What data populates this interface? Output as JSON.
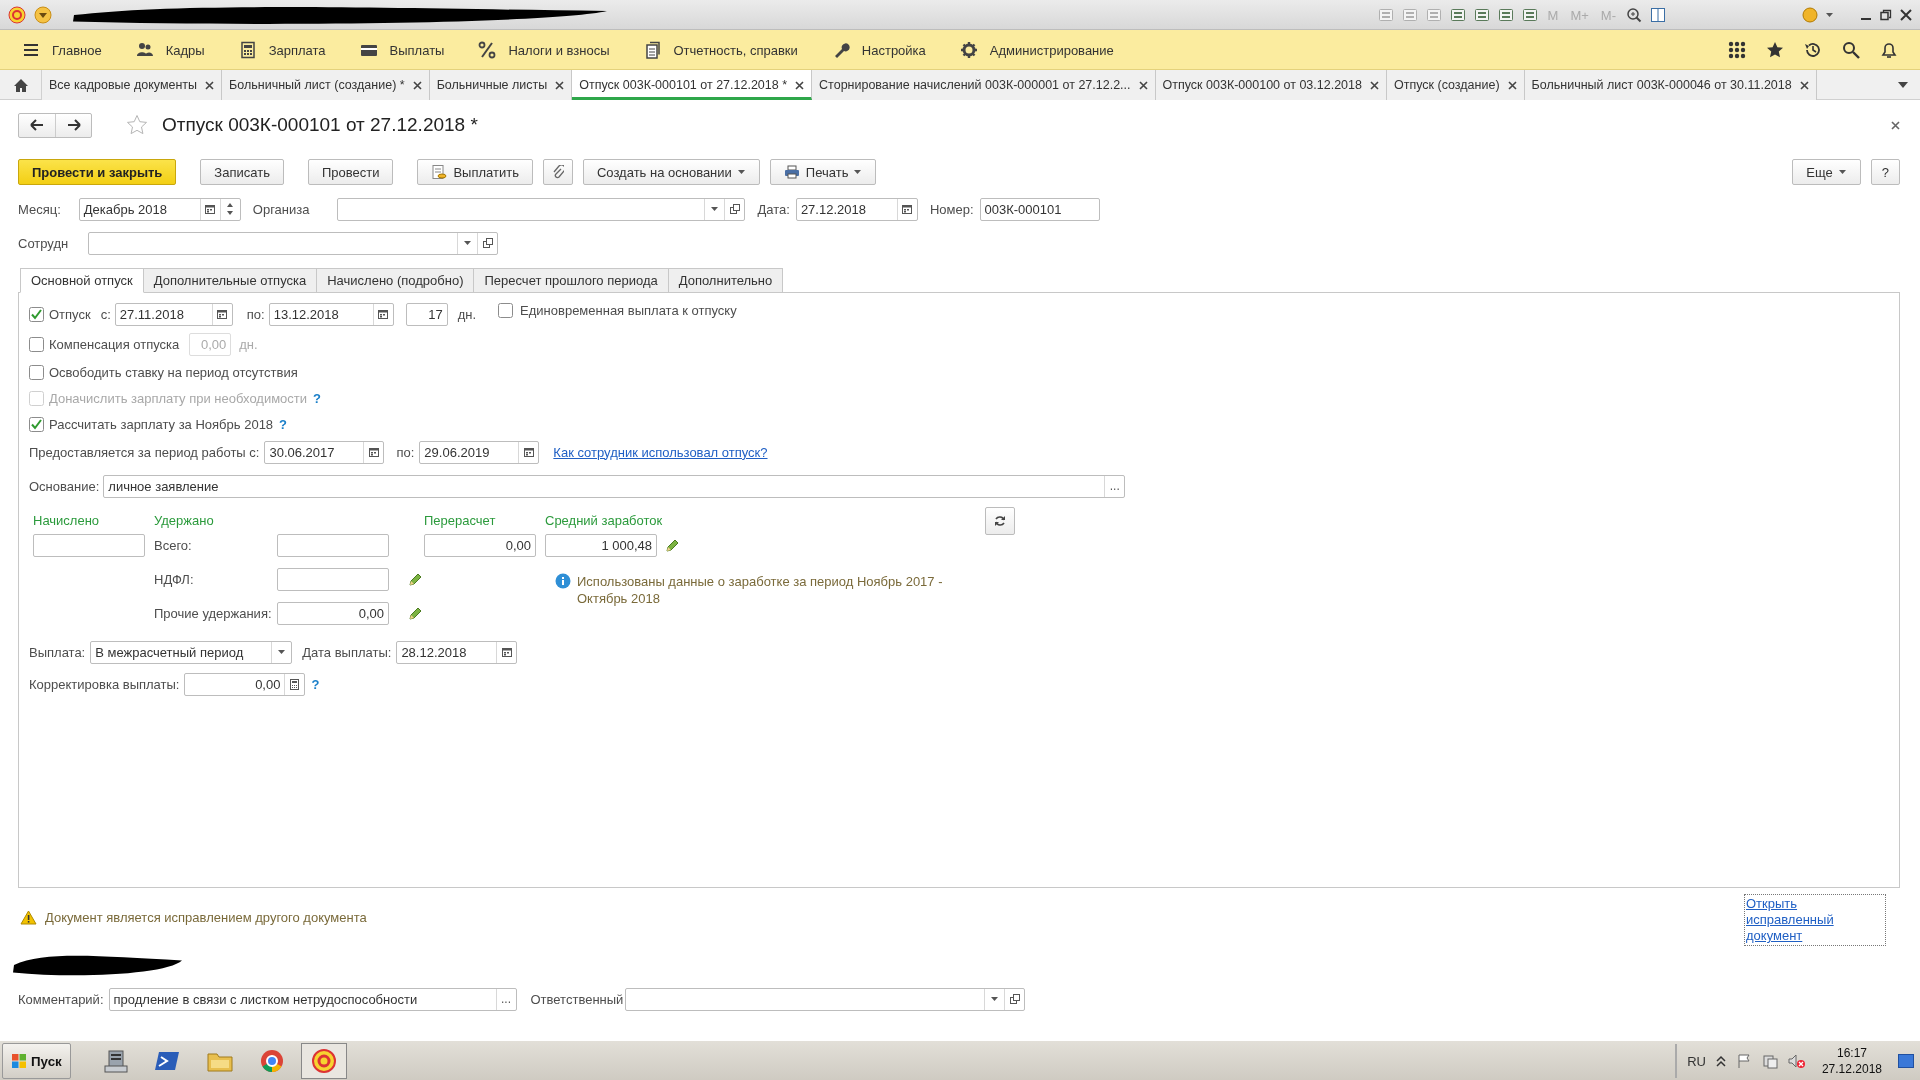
{
  "sections": [
    {
      "label": "Главное"
    },
    {
      "label": "Кадры"
    },
    {
      "label": "Зарплата"
    },
    {
      "label": "Выплаты"
    },
    {
      "label": "Налоги и взносы"
    },
    {
      "label": "Отчетность, справки"
    },
    {
      "label": "Настройка"
    },
    {
      "label": "Администрирование"
    }
  ],
  "open_tabs": [
    {
      "label": "Все кадровые документы",
      "selected": false
    },
    {
      "label": "Больничный лист (создание) *",
      "selected": false
    },
    {
      "label": "Больничные листы",
      "selected": false
    },
    {
      "label": "Отпуск 003К-000101 от 27.12.2018 *",
      "selected": true
    },
    {
      "label": "Сторнирование начислений 003К-000001 от 27.12.2...",
      "selected": false
    },
    {
      "label": "Отпуск 003К-000100 от 03.12.2018",
      "selected": false
    },
    {
      "label": "Отпуск (создание)",
      "selected": false
    },
    {
      "label": "Больничный лист 003К-000046 от 30.11.2018",
      "selected": false
    }
  ],
  "document": {
    "title": "Отпуск 003К-000101 от 27.12.2018 *",
    "starred": false
  },
  "commands": [
    {
      "kind": "primary",
      "label": "Провести и закрыть"
    },
    {
      "kind": "plain",
      "label": "Записать"
    },
    {
      "kind": "plain",
      "label": "Провести"
    },
    {
      "kind": "pay",
      "label": "Выплатить"
    },
    {
      "kind": "attach"
    },
    {
      "kind": "menu",
      "label": "Создать на основании"
    },
    {
      "kind": "print",
      "label": "Печать"
    }
  ],
  "more": "Еще",
  "help": "?",
  "month": {
    "label": "Месяц:",
    "value": "Декабрь 2018"
  },
  "organization": {
    "label": "Организа"
  },
  "date": {
    "label": "Дата:",
    "value": "27.12.2018"
  },
  "number": {
    "label": "Номер:",
    "value": "003К-000101"
  },
  "employee": {
    "label": "Сотрудн"
  },
  "form_tabs": [
    {
      "label": "Основной отпуск",
      "selected": true
    },
    {
      "label": "Дополнительные отпуска",
      "selected": false
    },
    {
      "label": "Начислено (подробно)",
      "selected": false
    },
    {
      "label": "Пересчет прошлого периода",
      "selected": false
    },
    {
      "label": "Дополнительно",
      "selected": false
    }
  ],
  "vacation": {
    "checked": true,
    "label": "Отпуск",
    "from_label": "с:",
    "from": "27.11.2018",
    "to_label": "по:",
    "to": "13.12.2018",
    "days": "17",
    "days_unit": "дн."
  },
  "one_time_payment": {
    "checked": false,
    "label": "Единовременная выплата к отпуску"
  },
  "compensation": {
    "checked": false,
    "disabled": true,
    "label": "Компенсация отпуска",
    "value": "0,00",
    "unit": "дн."
  },
  "options": [
    {
      "checked": false,
      "disabled": false,
      "label": "Освободить ставку на период отсутствия"
    },
    {
      "checked": false,
      "disabled": true,
      "label": "Доначислить зарплату при необходимости",
      "help": "?"
    },
    {
      "checked": true,
      "disabled": false,
      "label": "Рассчитать зарплату за Ноябрь 2018",
      "help": "?"
    }
  ],
  "work_period": {
    "label": "Предоставляется за период работы с:",
    "from": "30.06.2017",
    "to_label": "по:",
    "to": "29.06.2019",
    "link": "Как сотрудник использовал отпуск?"
  },
  "basis": {
    "label": "Основание:",
    "value": "личное заявление",
    "choice_button": "..."
  },
  "totals": {
    "accrued": {
      "heading": "Начислено"
    },
    "withheld": {
      "heading": "Удержано",
      "rows": [
        {
          "label": "Всего:",
          "editable": false
        },
        {
          "label": "НДФЛ:",
          "editable": true
        },
        {
          "label": "Прочие удержания:",
          "value": "0,00",
          "editable": true
        }
      ]
    },
    "recalc": {
      "heading": "Перерасчет",
      "value": "0,00"
    },
    "average": {
      "heading": "Средний заработок",
      "value": "1 000,48",
      "editable": true,
      "note": "Использованы данные о заработке за период Ноябрь 2017 - Октябрь 2018"
    }
  },
  "payment": {
    "label": "Выплата:",
    "value": "В межрасчетный период",
    "date_label": "Дата выплаты:",
    "date": "28.12.2018"
  },
  "correction": {
    "label": "Корректировка выплаты:",
    "value": "0,00",
    "help": "?"
  },
  "warning": "Документ является исправлением другого документа",
  "open_corrected_link": "Открыть исправленный документ",
  "comment": {
    "label": "Комментарий:",
    "value": "продление в связи с листком нетрудоспособности",
    "choice_button": "..."
  },
  "responsible": {
    "label": "Ответственный"
  },
  "memory_buttons": [
    "M",
    "M+",
    "M-"
  ],
  "taskbar": {
    "start": "Пуск",
    "language": "RU",
    "time": "16:17",
    "date": "27.12.2018"
  }
}
